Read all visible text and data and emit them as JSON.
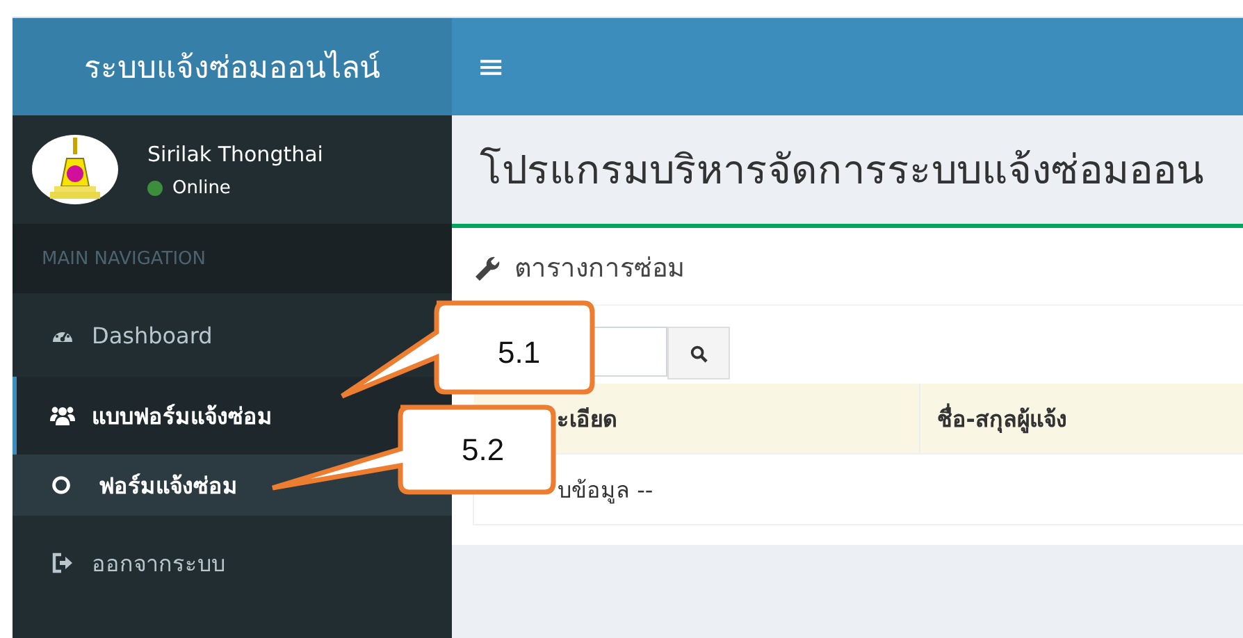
{
  "brand": "ระบบแจ้งซ่อมออนไลน์",
  "menu_toggle": "≡",
  "user": {
    "name": "Sirilak Thongthai",
    "status": "Online",
    "online": true
  },
  "nav_header": "MAIN NAVIGATION",
  "nav": [
    {
      "kind": "dashboard",
      "label": "Dashboard",
      "selected": false
    },
    {
      "kind": "users",
      "label": "แบบฟอร์มแจ้งซ่อม",
      "selected": true,
      "children": [
        {
          "kind": "circle",
          "label": "ฟอร์มแจ้งซ่อม",
          "selected": true
        }
      ]
    },
    {
      "kind": "logout",
      "label": "ออกจากระบบ",
      "selected": false
    }
  ],
  "page_title": "โปรแกรมบริหารจัดการระบบแจ้งซ่อมออน",
  "box": {
    "title": "ตารางการซ่อม"
  },
  "table": {
    "columns": [
      "ะเอียด",
      "ชื่อ-สกุลผู้แจ้ง"
    ],
    "empty_message": "บข้อมูล --"
  },
  "callouts": [
    {
      "label": "5.1"
    },
    {
      "label": "5.2"
    }
  ]
}
